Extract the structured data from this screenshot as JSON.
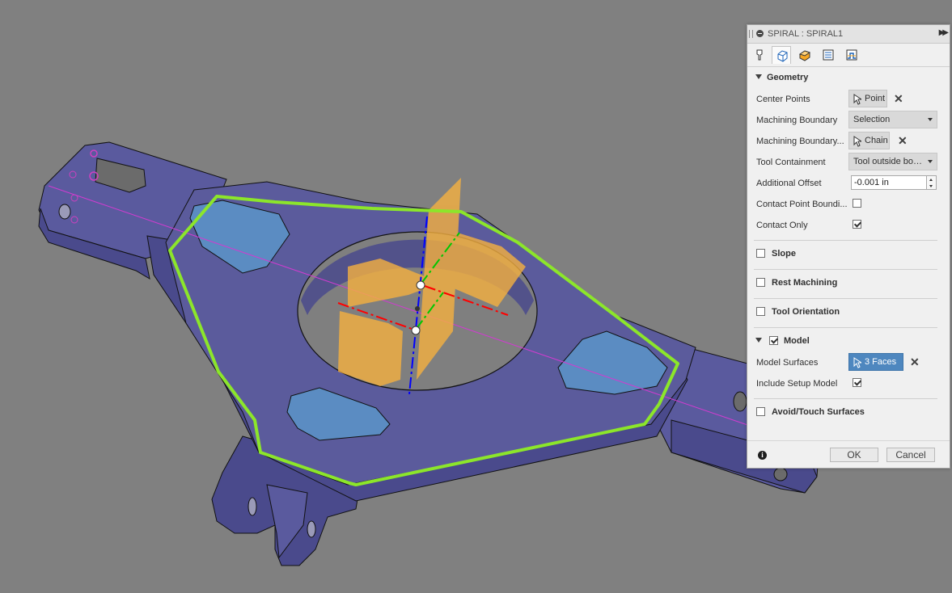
{
  "panel": {
    "title": "SPIRAL : SPIRAL1",
    "tabs": [
      {
        "name": "tool-tab",
        "active": false
      },
      {
        "name": "geometry-tab",
        "active": true
      },
      {
        "name": "heights-tab",
        "active": false
      },
      {
        "name": "passes-tab",
        "active": false
      },
      {
        "name": "linking-tab",
        "active": false
      }
    ],
    "geometry": {
      "header": "Geometry",
      "center_points_label": "Center Points",
      "center_points_value": "Point",
      "machining_boundary_label": "Machining Boundary",
      "machining_boundary_value": "Selection",
      "machining_boundary_sel_label": "Machining Boundary...",
      "machining_boundary_sel_value": "Chain",
      "tool_containment_label": "Tool Containment",
      "tool_containment_value": "Tool outside boundary",
      "additional_offset_label": "Additional Offset",
      "additional_offset_value": "-0.001 in",
      "contact_point_boundary_label": "Contact Point Boundi...",
      "contact_point_boundary_checked": false,
      "contact_only_label": "Contact Only",
      "contact_only_checked": true
    },
    "slope": {
      "label": "Slope",
      "checked": false
    },
    "rest_machining": {
      "label": "Rest Machining",
      "checked": false
    },
    "tool_orientation": {
      "label": "Tool Orientation",
      "checked": false
    },
    "model": {
      "label": "Model",
      "checked": true,
      "model_surfaces_label": "Model Surfaces",
      "model_surfaces_value": "3 Faces",
      "include_setup_label": "Include Setup Model",
      "include_setup_checked": true
    },
    "avoid_touch": {
      "label": "Avoid/Touch Surfaces",
      "checked": false
    },
    "footer": {
      "ok_label": "OK",
      "cancel_label": "Cancel"
    }
  },
  "colors": {
    "background": "#808080",
    "part_body": "#5b5b9c",
    "part_side": "#4a4a8c",
    "boundary_chain": "#8ce62a",
    "selected_faces": "#5b8cc2",
    "orange_planes": "#f5b040",
    "axis_red": "#ff0000",
    "axis_green": "#00c800",
    "axis_blue": "#0000ff",
    "highlight_button": "#4e87bf"
  }
}
